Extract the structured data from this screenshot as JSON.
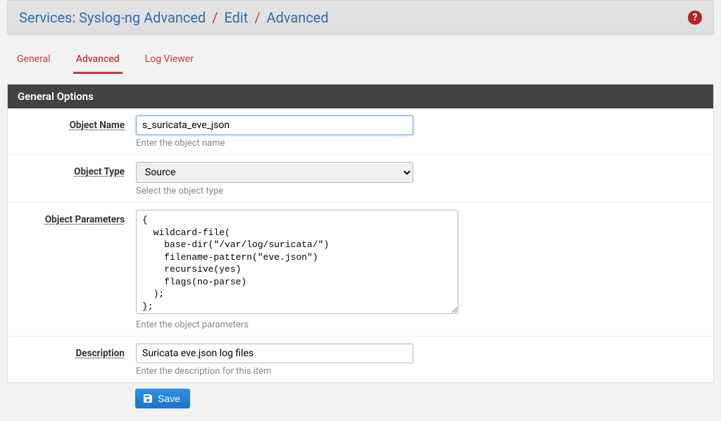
{
  "header": {
    "service": "Services: Syslog-ng Advanced",
    "crumb1": "Edit",
    "crumb2": "Advanced",
    "help_glyph": "?"
  },
  "tabs": [
    {
      "label": "General",
      "active": false
    },
    {
      "label": "Advanced",
      "active": true
    },
    {
      "label": "Log Viewer",
      "active": false
    }
  ],
  "card_title": "General Options",
  "fields": {
    "object_name": {
      "label": "Object Name",
      "value": "s_suricata_eve_json",
      "help": "Enter the object name"
    },
    "object_type": {
      "label": "Object Type",
      "value": "Source",
      "help": "Select the object type"
    },
    "object_parameters": {
      "label": "Object Parameters",
      "value": "{\n  wildcard-file(\n    base-dir(\"/var/log/suricata/\")\n    filename-pattern(\"eve.json\")\n    recursive(yes)\n    flags(no-parse)\n  );\n};",
      "help": "Enter the object parameters"
    },
    "description": {
      "label": "Description",
      "value": "Suricata eve.json log files",
      "help": "Enter the description for this item"
    }
  },
  "save_label": "Save"
}
